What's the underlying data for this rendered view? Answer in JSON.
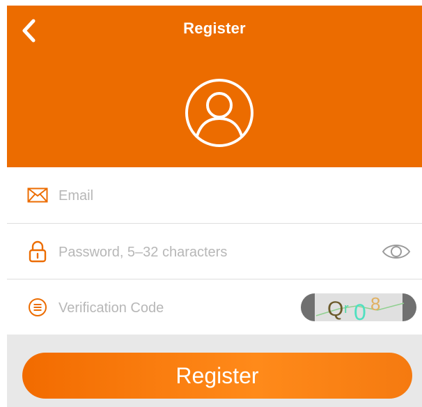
{
  "header": {
    "title": "Register",
    "back_icon": "chevron-left-icon",
    "avatar_icon": "user-avatar-icon",
    "color": "#ec6c00"
  },
  "form": {
    "email": {
      "placeholder": "Email",
      "value": "",
      "icon": "envelope-icon"
    },
    "password": {
      "placeholder": "Password, 5–32 characters",
      "value": "",
      "icon": "lock-icon",
      "toggle_icon": "eye-icon"
    },
    "verification": {
      "placeholder": "Verification Code",
      "value": "",
      "icon": "list-icon",
      "captcha_text": "Qr08"
    }
  },
  "actions": {
    "register_label": "Register",
    "accent": "#f57a10"
  }
}
